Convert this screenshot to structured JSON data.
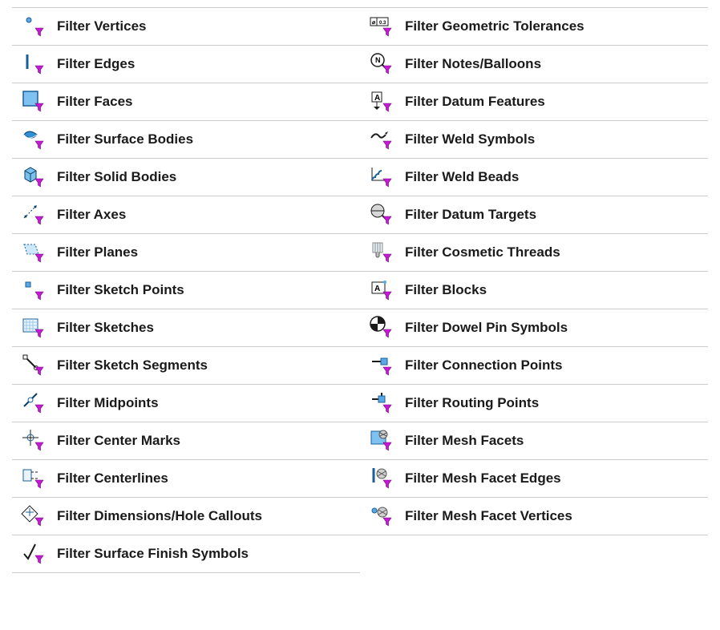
{
  "filters": {
    "left": [
      {
        "id": "vertices",
        "label": "Filter Vertices",
        "icon": "dot"
      },
      {
        "id": "edges",
        "label": "Filter Edges",
        "icon": "edge"
      },
      {
        "id": "faces",
        "label": "Filter Faces",
        "icon": "face"
      },
      {
        "id": "surface-bodies",
        "label": "Filter Surface Bodies",
        "icon": "surface"
      },
      {
        "id": "solid-bodies",
        "label": "Filter Solid Bodies",
        "icon": "solid"
      },
      {
        "id": "axes",
        "label": "Filter Axes",
        "icon": "axis"
      },
      {
        "id": "planes",
        "label": "Filter Planes",
        "icon": "plane"
      },
      {
        "id": "sketch-points",
        "label": "Filter Sketch Points",
        "icon": "sketchpoint"
      },
      {
        "id": "sketches",
        "label": "Filter Sketches",
        "icon": "sketch"
      },
      {
        "id": "sketch-segments",
        "label": "Filter Sketch Segments",
        "icon": "segment"
      },
      {
        "id": "midpoints",
        "label": "Filter Midpoints",
        "icon": "midpoint"
      },
      {
        "id": "center-marks",
        "label": "Filter Center Marks",
        "icon": "centermark"
      },
      {
        "id": "centerlines",
        "label": "Filter Centerlines",
        "icon": "centerline"
      },
      {
        "id": "dimensions",
        "label": "Filter Dimensions/Hole Callouts",
        "icon": "dimension"
      },
      {
        "id": "surface-finish",
        "label": "Filter Surface Finish Symbols",
        "icon": "surffinish"
      }
    ],
    "right": [
      {
        "id": "geo-tol",
        "label": "Filter Geometric Tolerances",
        "icon": "gtol"
      },
      {
        "id": "notes",
        "label": "Filter Notes/Balloons",
        "icon": "note"
      },
      {
        "id": "datum-features",
        "label": "Filter Datum Features",
        "icon": "datumfeat"
      },
      {
        "id": "weld-symbols",
        "label": "Filter Weld Symbols",
        "icon": "weldsym"
      },
      {
        "id": "weld-beads",
        "label": "Filter Weld Beads",
        "icon": "weldbead"
      },
      {
        "id": "datum-targets",
        "label": "Filter Datum Targets",
        "icon": "datumtgt"
      },
      {
        "id": "cosmetic-threads",
        "label": "Filter Cosmetic Threads",
        "icon": "thread"
      },
      {
        "id": "blocks",
        "label": "Filter Blocks",
        "icon": "block"
      },
      {
        "id": "dowel",
        "label": "Filter Dowel Pin Symbols",
        "icon": "dowel"
      },
      {
        "id": "connection-points",
        "label": "Filter Connection Points",
        "icon": "connpt"
      },
      {
        "id": "routing-points",
        "label": "Filter Routing Points",
        "icon": "routept"
      },
      {
        "id": "mesh-facets",
        "label": "Filter Mesh Facets",
        "icon": "meshfacet"
      },
      {
        "id": "mesh-edges",
        "label": "Filter Mesh Facet Edges",
        "icon": "meshedge"
      },
      {
        "id": "mesh-vertices",
        "label": "Filter Mesh Facet Vertices",
        "icon": "meshvert"
      }
    ]
  }
}
